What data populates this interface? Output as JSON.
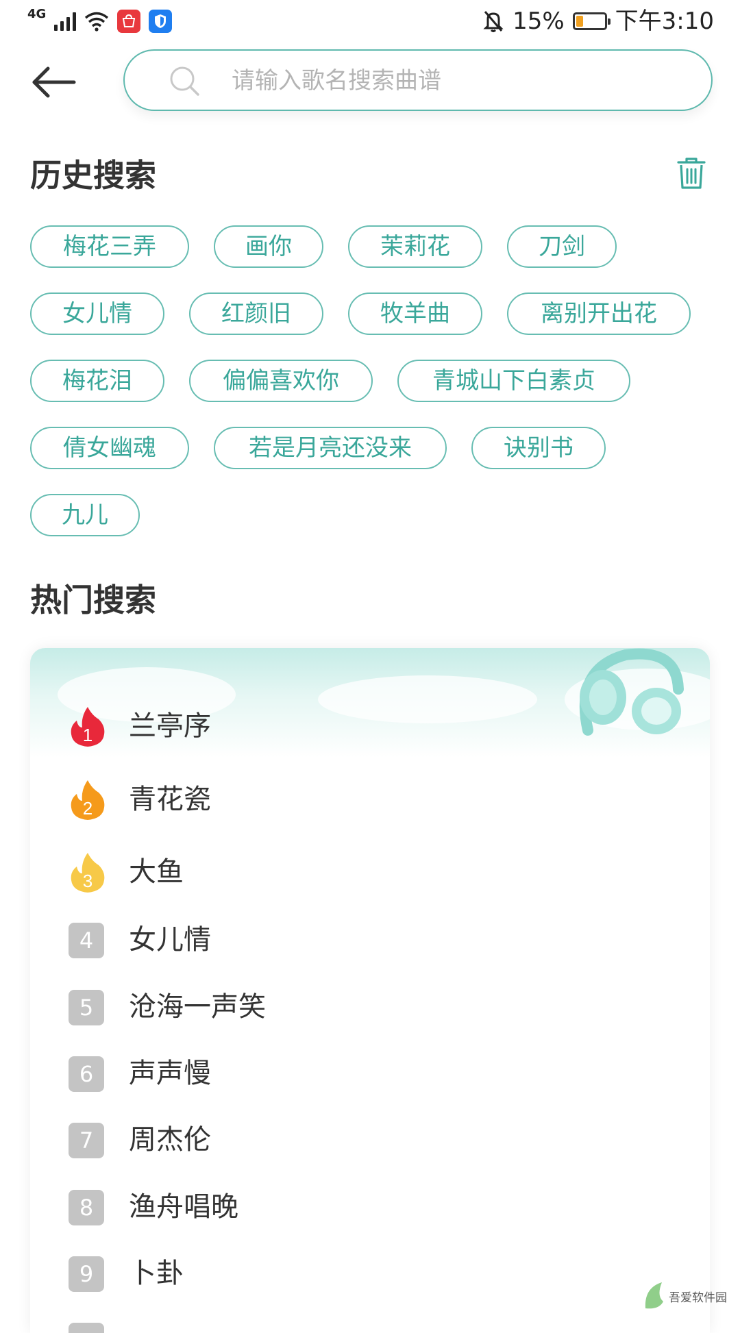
{
  "status_bar": {
    "network": "4G",
    "battery_percent": "15%",
    "time": "下午3:10"
  },
  "search": {
    "placeholder": "请输入歌名搜索曲谱",
    "value": ""
  },
  "history": {
    "title": "历史搜索",
    "tags": [
      "梅花三弄",
      "画你",
      "茉莉花",
      "刀剑",
      "女儿情",
      "红颜旧",
      "牧羊曲",
      "离别开出花",
      "梅花泪",
      "偏偏喜欢你",
      "青城山下白素贞",
      "倩女幽魂",
      "若是月亮还没来",
      "诀别书",
      "九儿"
    ]
  },
  "hot": {
    "title": "热门搜索",
    "items": [
      {
        "rank": "1",
        "name": "兰亭序"
      },
      {
        "rank": "2",
        "name": "青花瓷"
      },
      {
        "rank": "3",
        "name": "大鱼"
      },
      {
        "rank": "4",
        "name": "女儿情"
      },
      {
        "rank": "5",
        "name": "沧海一声笑"
      },
      {
        "rank": "6",
        "name": "声声慢"
      },
      {
        "rank": "7",
        "name": "周杰伦"
      },
      {
        "rank": "8",
        "name": "渔舟唱晚"
      },
      {
        "rank": "9",
        "name": "卜卦"
      }
    ]
  },
  "colors": {
    "accent": "#3aa79a",
    "rank1": "#e8283a",
    "rank2": "#f59a1b",
    "rank3": "#f7c948",
    "rank_other": "#c4c4c4"
  },
  "watermark": {
    "text": "吾爱软件园"
  }
}
